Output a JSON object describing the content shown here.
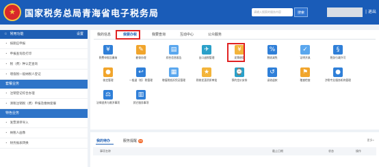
{
  "header": {
    "site_title": "国家税务总局青海省电子税务局",
    "emblem_glyph": "★",
    "search_placeholder": "请输入搜索的服务内容",
    "search_button": "搜索",
    "logout": "| 退出"
  },
  "sidebar": {
    "head": {
      "label": "常用功能",
      "settings": "设置"
    },
    "items": [
      "按期应申报",
      "申报查询及打印",
      "税（费）种认定查询",
      "增值税一般纳税人登记"
    ],
    "groups": [
      {
        "label": "套餐业务",
        "items": [
          "注销登记综合办理",
          "清税注销税（费）申报及缴纳套餐"
        ]
      },
      {
        "label": "特色业务",
        "items": [
          "发票清单导入",
          "纳税人画像",
          "财务报表转换"
        ]
      }
    ]
  },
  "tabs": [
    "我的信息",
    "我要办税",
    "我要查询",
    "互动中心",
    "公众服务"
  ],
  "active_tab_index": 1,
  "tiles": [
    {
      "label": "税费申报及缴纳",
      "icon": "tax-declaration-icon",
      "color": "#2f7fd8"
    },
    {
      "label": "套餐办理",
      "icon": "package-handling-icon",
      "color": "#f1a52c"
    },
    {
      "label": "综合信息报告",
      "icon": "info-report-icon",
      "color": "#5aa7ee"
    },
    {
      "label": "出口退税管理",
      "icon": "export-refund-icon",
      "color": "#2aa0c9"
    },
    {
      "label": "发票使用",
      "icon": "invoice-icon",
      "color": "#f3b43a"
    },
    {
      "label": "税收减免",
      "icon": "tax-reduction-icon",
      "color": "#2f7fd8"
    },
    {
      "label": "证明开具",
      "icon": "certificate-icon",
      "color": "#5aa7ee"
    },
    {
      "label": "税务行政许可",
      "icon": "admin-permit-icon",
      "color": "#2f7fd8"
    },
    {
      "label": "核定管理",
      "icon": "verification-icon",
      "color": "#f1a52c"
    },
    {
      "label": "一般退（抵）税管理",
      "icon": "refund-icon",
      "color": "#2f7fd8"
    },
    {
      "label": "增值税抵扣凭证管理",
      "icon": "vat-deduction-icon",
      "color": "#5aa7ee"
    },
    {
      "label": "税收优惠资质审批",
      "icon": "tax-benefit-icon",
      "color": "#f3b43a"
    },
    {
      "label": "预约定价安排",
      "icon": "pricing-icon",
      "color": "#2aa0c9"
    },
    {
      "label": "误收退款",
      "icon": "mistaken-refund-icon",
      "color": "#2f7fd8"
    },
    {
      "label": "稽查检查",
      "icon": "inspection-icon",
      "color": "#f1a52c"
    },
    {
      "label": "涉税专业服务机构管理",
      "icon": "agency-management-icon",
      "color": "#2f7fd8"
    },
    {
      "label": "法律追责与救济事项",
      "icon": "legal-remedy-icon",
      "color": "#2f7fd8"
    },
    {
      "label": "其它服务事项",
      "icon": "other-services-icon",
      "color": "#2f7fd8"
    }
  ],
  "bottom": {
    "tabs": [
      "我的待办",
      "服务提醒"
    ],
    "badge": "99",
    "more": "更多»",
    "columns": [
      "事项名称",
      "截止日期",
      "状态",
      "操作"
    ]
  },
  "colors": {
    "header_blue": "#1a5cb8",
    "accent_red": "#e02020",
    "active_blue": "#1f5fb4"
  }
}
